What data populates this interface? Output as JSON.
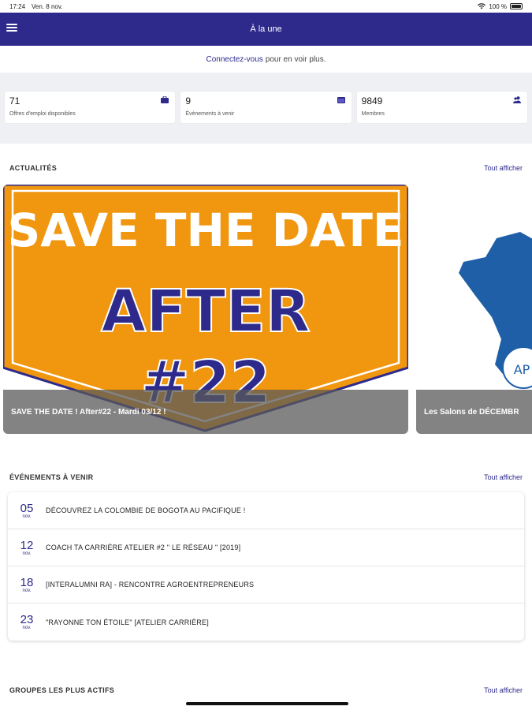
{
  "status": {
    "time": "17:24",
    "date": "Ven. 8 nov.",
    "battery": "100 %"
  },
  "header": {
    "title": "À la une"
  },
  "login_prompt": {
    "link": "Connectez-vous",
    "text": "pour en voir plus."
  },
  "stats": [
    {
      "value": "71",
      "label": "Offres d'emploi disponibles",
      "icon": "briefcase-icon"
    },
    {
      "value": "9",
      "label": "Évènements à venir",
      "icon": "calendar-icon"
    },
    {
      "value": "9849",
      "label": "Membres",
      "icon": "members-icon"
    }
  ],
  "news": {
    "title": "ACTUALITÉS",
    "see_all": "Tout afficher",
    "items": [
      {
        "caption": "SAVE THE DATE ! After#22 - Mardi 03/12 !",
        "banner_top": "SAVE THE DATE",
        "banner_mid": "AFTER",
        "banner_bottom": "#22"
      },
      {
        "caption": "Les Salons de DÉCEMBR",
        "logo_text": "AP"
      }
    ]
  },
  "events": {
    "title": "ÉVÉNEMENTS À VENIR",
    "see_all": "Tout afficher",
    "items": [
      {
        "day": "05",
        "month": "nov.",
        "title": "DÉCOUVREZ LA COLOMBIE DE BOGOTA AU PACIFIQUE !"
      },
      {
        "day": "12",
        "month": "nov.",
        "title": "COACH TA CARRIÈRE ATELIER #2 \" LE RÉSEAU \" [2019]"
      },
      {
        "day": "18",
        "month": "nov.",
        "title": "[INTERALUMNI RA] - RENCONTRE AGROENTREPRENEURS"
      },
      {
        "day": "23",
        "month": "nov.",
        "title": "\"RAYONNE TON ÉTOILE\" [ATELIER CARRIÈRE]"
      }
    ]
  },
  "groups": {
    "title": "GROUPES LES PLUS ACTIFS",
    "see_all": "Tout afficher"
  },
  "colors": {
    "primary": "#2d2a8c",
    "banner_orange": "#f0960f"
  }
}
